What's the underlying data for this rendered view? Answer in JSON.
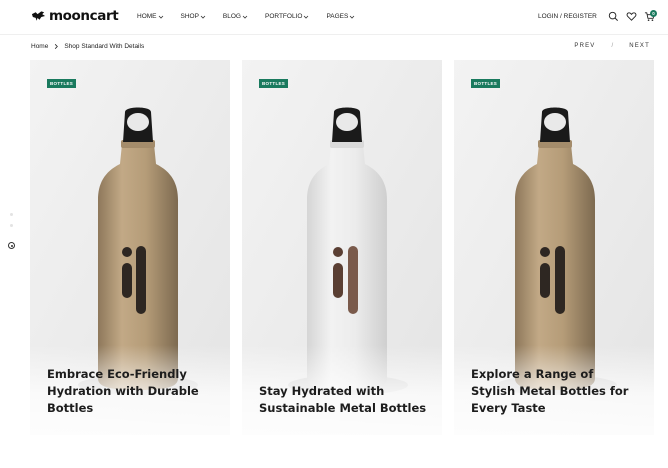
{
  "brand": {
    "name": "mooncart",
    "logo_icon": "bird-icon"
  },
  "nav": {
    "items": [
      {
        "label": "HOME"
      },
      {
        "label": "SHOP"
      },
      {
        "label": "BLOG"
      },
      {
        "label": "PORTFOLIO"
      },
      {
        "label": "PAGES"
      }
    ],
    "login_label": "LOGIN / REGISTER",
    "icons": [
      "search-icon",
      "heart-icon",
      "cart-icon"
    ],
    "cart_count": "0"
  },
  "breadcrumb": {
    "home": "Home",
    "current": "Shop Standard With Details"
  },
  "pager": {
    "prev": "PREV",
    "sep": "/",
    "next": "NEXT"
  },
  "colors": {
    "accent": "#1a7a5e",
    "card_bg": "#eeeeee",
    "gold_bottle": "#b39a78",
    "white_bottle": "#e6e6e6",
    "cap": "#1a1a1a"
  },
  "cards": [
    {
      "badge": "BOTTLES",
      "title": "Embrace Eco-Friendly Hydration with Durable Bottles",
      "bottle": "gold"
    },
    {
      "badge": "BOTTLES",
      "title": "Stay Hydrated with Sustainable Metal Bottles",
      "bottle": "white"
    },
    {
      "badge": "BOTTLES",
      "title": "Explore a Range of Stylish Metal Bottles for Every Taste",
      "bottle": "gold"
    }
  ]
}
